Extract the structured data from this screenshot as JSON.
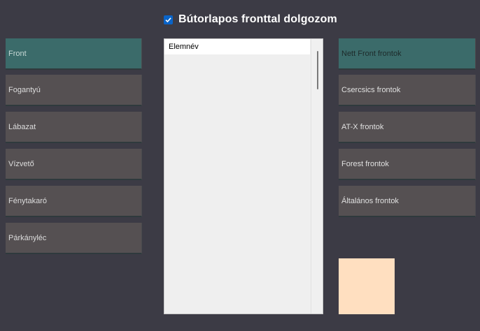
{
  "header": {
    "checkbox_checked": true,
    "label": "Bútorlapos fronttal dolgozom"
  },
  "left_buttons": [
    {
      "label": "Front",
      "active": true
    },
    {
      "label": "Fogantyú",
      "active": false
    },
    {
      "label": "Lábazat",
      "active": false
    },
    {
      "label": "Vízvető",
      "active": false
    },
    {
      "label": "Fénytakaró",
      "active": false
    },
    {
      "label": "Párkányléc",
      "active": false
    }
  ],
  "list": {
    "header": "Elemnév",
    "items": []
  },
  "right_buttons": [
    {
      "label": "Nett Front frontok",
      "active": true
    },
    {
      "label": "Csercsics frontok",
      "active": false
    },
    {
      "label": "AT-X frontok",
      "active": false
    },
    {
      "label": "Forest frontok",
      "active": false
    },
    {
      "label": "Általános frontok",
      "active": false
    }
  ],
  "colors": {
    "background": "#3c3b45",
    "button": "#555052",
    "button_active": "#3b6b6a",
    "swatch": "#ffdfc0",
    "checkbox": "#0a64c8"
  }
}
